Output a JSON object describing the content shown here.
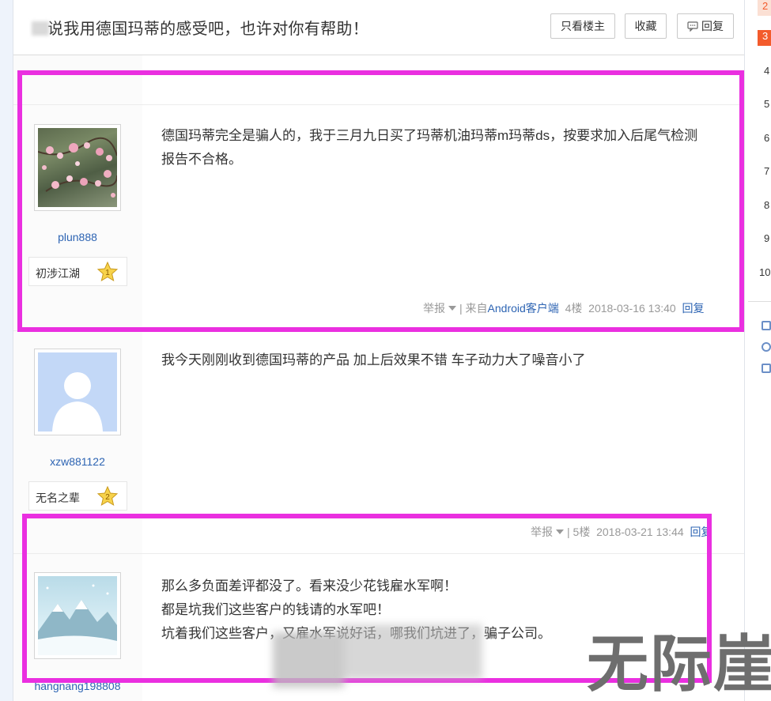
{
  "thread": {
    "title": "说我用德国玛蒂的感受吧，也许对你有帮助！",
    "btn_only_op": "只看楼主",
    "btn_collect": "收藏",
    "btn_reply": "回复"
  },
  "pager": [
    "2",
    "3",
    "4",
    "5",
    "6",
    "7",
    "8",
    "9",
    "10"
  ],
  "posts": [
    {
      "username": "plun888",
      "rank": "初涉江湖",
      "level": "1",
      "text_line1": "德国玛蒂完全是骗人的，我于三月九日买了玛蒂机油玛蒂m玛蒂ds，按要求加入后尾气检测",
      "text_line2": "报告不合格。",
      "report": "举报",
      "source_prefix": "来自",
      "source_client": "Android客户端",
      "floor": "4楼",
      "time": "2018-03-16 13:40",
      "reply": "回复"
    },
    {
      "username": "xzw881122",
      "rank": "无名之辈",
      "level": "2",
      "text_line1": "我今天刚刚收到德国玛蒂的产品 加上后效果不错 车子动力大了噪音小了",
      "report": "举报",
      "floor": "5楼",
      "time": "2018-03-21 13:44",
      "reply": "回复"
    },
    {
      "username": "hangnang198808",
      "text_line1": "那么多负面差评都没了。看来没少花钱雇水军啊！",
      "text_line2": "都是坑我们这些客户的钱请的水军吧！",
      "text_line3": "坑着我们这些客户，又雇水军说好话，哪我们坑进了，骗子公司。"
    }
  ],
  "watermark": "无际崖",
  "colors": {
    "highlight": "#ea2fe0",
    "link": "#2d64b3",
    "pager_active": "#f35b2c"
  }
}
